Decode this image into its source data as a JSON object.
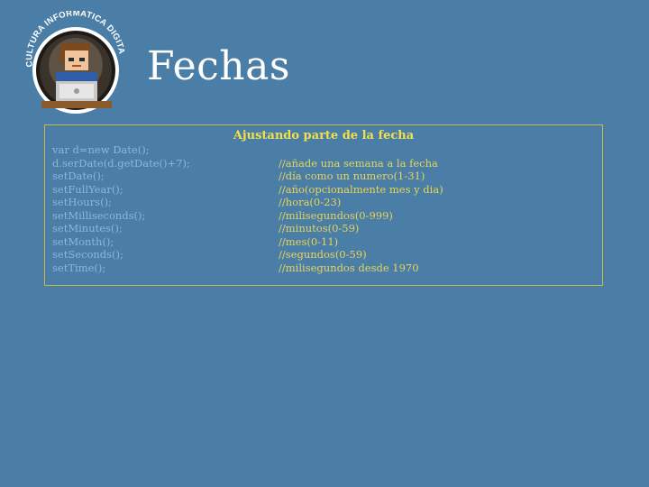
{
  "header": {
    "title": "Fechas",
    "logo_text": "CULTURA INFORMATICA DIGITAL"
  },
  "panel": {
    "heading": "Ajustando parte de la fecha",
    "rows": [
      {
        "code": "var d=new Date();",
        "comment": ""
      },
      {
        "code": "d.serDate(d.getDate()+7);",
        "comment": "//añade una semana a la fecha"
      },
      {
        "code": "setDate();",
        "comment": "//día como un numero(1-31)"
      },
      {
        "code": "setFullYear();",
        "comment": "//año(opcionalmente mes y dia)"
      },
      {
        "code": "setHours();",
        "comment": "//hora(0-23)"
      },
      {
        "code": "setMilliseconds();",
        "comment": "//milisegundos(0-999)"
      },
      {
        "code": "setMinutes();",
        "comment": "//minutos(0-59)"
      },
      {
        "code": "setMonth();",
        "comment": "//mes(0-11)"
      },
      {
        "code": "setSeconds();",
        "comment": "//segundos(0-59)"
      },
      {
        "code": "setTime();",
        "comment": "//milisegundos desde 1970"
      }
    ]
  },
  "colors": {
    "background": "#4a7ea6",
    "heading": "#f2e04a",
    "code": "#8ab8d9",
    "comment": "#e8d45a",
    "border": "#c9b84a"
  },
  "icons": {
    "logo": "programmer-at-laptop-icon"
  }
}
